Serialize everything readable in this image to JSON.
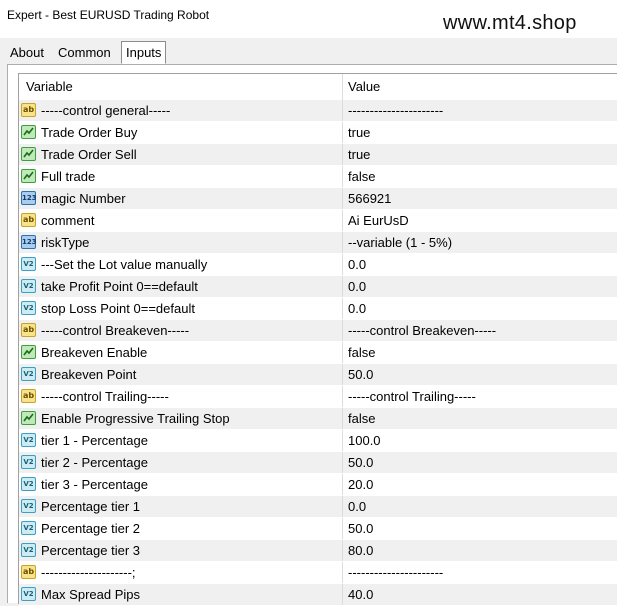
{
  "window": {
    "title": "Expert - Best EURUSD Trading Robot",
    "watermark": "www.mt4.shop"
  },
  "tabs": [
    {
      "label": "About"
    },
    {
      "label": "Common"
    },
    {
      "label": "Inputs"
    }
  ],
  "table": {
    "headers": {
      "variable": "Variable",
      "value": "Value"
    },
    "rows": [
      {
        "type": "ab",
        "icon": "string-icon",
        "variable": "-----control general-----",
        "value": "----------------------"
      },
      {
        "type": "bool",
        "icon": "boolean-icon",
        "variable": "Trade Order Buy",
        "value": "true"
      },
      {
        "type": "bool",
        "icon": "boolean-icon",
        "variable": "Trade Order Sell",
        "value": "true"
      },
      {
        "type": "bool",
        "icon": "boolean-icon",
        "variable": "Full trade",
        "value": "false"
      },
      {
        "type": "int",
        "icon": "integer-icon",
        "variable": "magic Number",
        "value": "566921"
      },
      {
        "type": "ab",
        "icon": "string-icon",
        "variable": "comment",
        "value": "Ai EurUsD"
      },
      {
        "type": "int",
        "icon": "integer-icon",
        "variable": "riskType",
        "value": "--variable (1 - 5%)"
      },
      {
        "type": "dbl",
        "icon": "double-icon",
        "variable": "---Set the Lot value manually",
        "value": "0.0"
      },
      {
        "type": "dbl",
        "icon": "double-icon",
        "variable": "take Profit Point 0==default",
        "value": "0.0"
      },
      {
        "type": "dbl",
        "icon": "double-icon",
        "variable": "stop Loss Point  0==default",
        "value": "0.0"
      },
      {
        "type": "ab",
        "icon": "string-icon",
        "variable": "-----control Breakeven-----",
        "value": "-----control Breakeven-----"
      },
      {
        "type": "bool",
        "icon": "boolean-icon",
        "variable": "Breakeven Enable",
        "value": "false"
      },
      {
        "type": "dbl",
        "icon": "double-icon",
        "variable": "Breakeven Point",
        "value": "50.0"
      },
      {
        "type": "ab",
        "icon": "string-icon",
        "variable": "-----control Trailing-----",
        "value": "-----control Trailing-----"
      },
      {
        "type": "bool",
        "icon": "boolean-icon",
        "variable": "Enable Progressive Trailing Stop",
        "value": "false"
      },
      {
        "type": "dbl",
        "icon": "double-icon",
        "variable": "tier 1 - Percentage",
        "value": "100.0"
      },
      {
        "type": "dbl",
        "icon": "double-icon",
        "variable": "tier 2 - Percentage",
        "value": "50.0"
      },
      {
        "type": "dbl",
        "icon": "double-icon",
        "variable": "tier 3 - Percentage",
        "value": "20.0"
      },
      {
        "type": "dbl",
        "icon": "double-icon",
        "variable": "Percentage tier 1",
        "value": "0.0"
      },
      {
        "type": "dbl",
        "icon": "double-icon",
        "variable": "Percentage tier 2",
        "value": "50.0"
      },
      {
        "type": "dbl",
        "icon": "double-icon",
        "variable": "Percentage tier 3",
        "value": "80.0"
      },
      {
        "type": "ab",
        "icon": "string-icon",
        "variable": "---------------------;",
        "value": "----------------------"
      },
      {
        "type": "dbl",
        "icon": "double-icon",
        "variable": "Max Spread Pips",
        "value": "40.0"
      }
    ]
  }
}
